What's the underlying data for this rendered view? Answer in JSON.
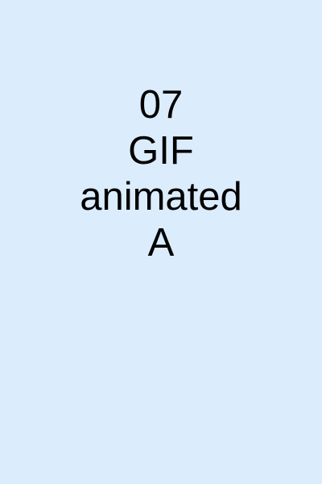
{
  "caption": {
    "lines": [
      "07",
      "GIF",
      "animated",
      "A"
    ]
  },
  "colors": {
    "background": "#dbecfc",
    "text": "#000000"
  }
}
